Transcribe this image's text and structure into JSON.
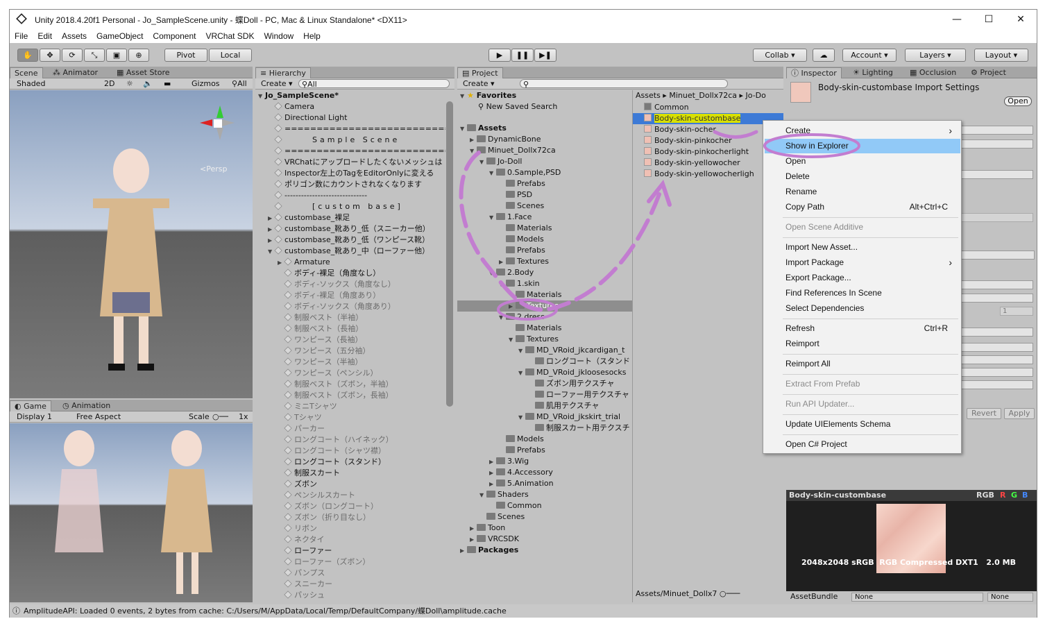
{
  "title": "Unity 2018.4.20f1 Personal - Jo_SampleScene.unity - 蝶Doll - PC, Mac & Linux Standalone* <DX11>",
  "menu": [
    "File",
    "Edit",
    "Assets",
    "GameObject",
    "Component",
    "VRChat SDK",
    "Window",
    "Help"
  ],
  "toolbar": {
    "pivot": "Pivot",
    "local": "Local",
    "collab": "Collab ▾",
    "account": "Account",
    "layers": "Layers",
    "layout": "Layout"
  },
  "scene": {
    "tabs": [
      "Scene",
      "Animator",
      "Asset Store"
    ],
    "shaded": "Shaded",
    "mode2d": "2D",
    "gizmos": "Gizmos",
    "persp": "<Persp",
    "search": "All"
  },
  "game": {
    "tabs": [
      "Game",
      "Animation"
    ],
    "display": "Display 1",
    "aspect": "Free Aspect",
    "scale": "Scale",
    "scale_val": "1x"
  },
  "hierarchy": {
    "tab": "Hierarchy",
    "create": "Create",
    "search": "All",
    "scene": "Jo_SampleScene*",
    "items": [
      {
        "t": "Camera",
        "d": 1,
        "g": false,
        "a": ""
      },
      {
        "t": "Directional Light",
        "d": 1,
        "g": false,
        "a": ""
      },
      {
        "t": "==============================",
        "d": 1,
        "g": false,
        "a": ""
      },
      {
        "t": "Sample Scene",
        "d": 1,
        "g": false,
        "a": "",
        "c": true
      },
      {
        "t": "==============================",
        "d": 1,
        "g": false,
        "a": ""
      },
      {
        "t": "VRChatにアップロードしたくないメッシュは",
        "d": 1,
        "g": false,
        "a": ""
      },
      {
        "t": "Inspector左上のTagをEditorOnlyに変える",
        "d": 1,
        "g": false,
        "a": ""
      },
      {
        "t": "ポリゴン数にカウントされなくなります",
        "d": 1,
        "g": false,
        "a": ""
      },
      {
        "t": "------------------------------",
        "d": 1,
        "g": false,
        "a": ""
      },
      {
        "t": "[custom base]",
        "d": 1,
        "g": false,
        "a": "",
        "c": true
      },
      {
        "t": "custombase_裸足",
        "d": 1,
        "g": false,
        "a": "▶"
      },
      {
        "t": "custombase_靴あり_低（スニーカー他）",
        "d": 1,
        "g": false,
        "a": "▶"
      },
      {
        "t": "custombase_靴あり_低（ワンピース靴）",
        "d": 1,
        "g": false,
        "a": "▶"
      },
      {
        "t": "custombase_靴あり_中（ローファー他）",
        "d": 1,
        "g": false,
        "a": "▼"
      },
      {
        "t": "Armature",
        "d": 2,
        "g": false,
        "a": "▶"
      },
      {
        "t": "ボディ-裸足（角度なし）",
        "d": 2,
        "g": false,
        "a": ""
      },
      {
        "t": "ボディ-ソックス（角度なし）",
        "d": 2,
        "g": true,
        "a": ""
      },
      {
        "t": "ボディ-裸足（角度あり）",
        "d": 2,
        "g": true,
        "a": ""
      },
      {
        "t": "ボディ-ソックス（角度あり）",
        "d": 2,
        "g": true,
        "a": ""
      },
      {
        "t": "制服ベスト（半袖）",
        "d": 2,
        "g": true,
        "a": ""
      },
      {
        "t": "制服ベスト（長袖）",
        "d": 2,
        "g": true,
        "a": ""
      },
      {
        "t": "ワンピース（長袖）",
        "d": 2,
        "g": true,
        "a": ""
      },
      {
        "t": "ワンピース（五分袖）",
        "d": 2,
        "g": true,
        "a": ""
      },
      {
        "t": "ワンピース（半袖）",
        "d": 2,
        "g": true,
        "a": ""
      },
      {
        "t": "ワンピース（ペンシル）",
        "d": 2,
        "g": true,
        "a": ""
      },
      {
        "t": "制服ベスト（ズボン，半袖）",
        "d": 2,
        "g": true,
        "a": ""
      },
      {
        "t": "制服ベスト（ズボン，長袖）",
        "d": 2,
        "g": true,
        "a": ""
      },
      {
        "t": "ミニTシャツ",
        "d": 2,
        "g": true,
        "a": ""
      },
      {
        "t": "Tシャツ",
        "d": 2,
        "g": true,
        "a": ""
      },
      {
        "t": "パーカー",
        "d": 2,
        "g": true,
        "a": ""
      },
      {
        "t": "ロングコート（ハイネック）",
        "d": 2,
        "g": true,
        "a": ""
      },
      {
        "t": "ロングコート（シャツ襟）",
        "d": 2,
        "g": true,
        "a": ""
      },
      {
        "t": "ロングコート（スタンド）",
        "d": 2,
        "g": false,
        "a": ""
      },
      {
        "t": "制服スカート",
        "d": 2,
        "g": false,
        "a": ""
      },
      {
        "t": "ズボン",
        "d": 2,
        "g": false,
        "a": ""
      },
      {
        "t": "ペンシルスカート",
        "d": 2,
        "g": true,
        "a": ""
      },
      {
        "t": "ズボン（ロングコート）",
        "d": 2,
        "g": true,
        "a": ""
      },
      {
        "t": "ズボン（折り目なし）",
        "d": 2,
        "g": true,
        "a": ""
      },
      {
        "t": "リボン",
        "d": 2,
        "g": true,
        "a": ""
      },
      {
        "t": "ネクタイ",
        "d": 2,
        "g": true,
        "a": ""
      },
      {
        "t": "ローファー",
        "d": 2,
        "g": false,
        "a": ""
      },
      {
        "t": "ローファー（ズボン）",
        "d": 2,
        "g": true,
        "a": ""
      },
      {
        "t": "パンプス",
        "d": 2,
        "g": true,
        "a": ""
      },
      {
        "t": "スニーカー",
        "d": 2,
        "g": true,
        "a": ""
      },
      {
        "t": "パッシュ",
        "d": 2,
        "g": true,
        "a": ""
      }
    ]
  },
  "project": {
    "tab": "Project",
    "create": "Create",
    "favorites": "Favorites",
    "new_saved_search": "New Saved Search",
    "assets": "Assets",
    "packages": "Packages",
    "tree": [
      {
        "t": "DynamicBone",
        "d": 1,
        "a": "▶"
      },
      {
        "t": "Minuet_Dollx72ca",
        "d": 1,
        "a": "▼"
      },
      {
        "t": "Jo-Doll",
        "d": 2,
        "a": "▼"
      },
      {
        "t": "0.Sample,PSD",
        "d": 3,
        "a": "▼"
      },
      {
        "t": "Prefabs",
        "d": 4,
        "a": ""
      },
      {
        "t": "PSD",
        "d": 4,
        "a": ""
      },
      {
        "t": "Scenes",
        "d": 4,
        "a": ""
      },
      {
        "t": "1.Face",
        "d": 3,
        "a": "▼"
      },
      {
        "t": "Materials",
        "d": 4,
        "a": ""
      },
      {
        "t": "Models",
        "d": 4,
        "a": ""
      },
      {
        "t": "Prefabs",
        "d": 4,
        "a": ""
      },
      {
        "t": "Textures",
        "d": 4,
        "a": "▶"
      },
      {
        "t": "2.Body",
        "d": 3,
        "a": "▼"
      },
      {
        "t": "1.skin",
        "d": 4,
        "a": "▼"
      },
      {
        "t": "Materials",
        "d": 5,
        "a": ""
      },
      {
        "t": "Textures",
        "d": 5,
        "a": "▶",
        "sel": true
      },
      {
        "t": "2.dress",
        "d": 4,
        "a": "▼"
      },
      {
        "t": "Materials",
        "d": 5,
        "a": ""
      },
      {
        "t": "Textures",
        "d": 5,
        "a": "▼"
      },
      {
        "t": "MD_VRoid_jkcardigan_t",
        "d": 6,
        "a": "▼"
      },
      {
        "t": "ロングコート（スタンド",
        "d": 7,
        "a": ""
      },
      {
        "t": "MD_VRoid_jkloosesocks",
        "d": 6,
        "a": "▼"
      },
      {
        "t": "ズボン用テクスチャ",
        "d": 7,
        "a": ""
      },
      {
        "t": "ローファー用テクスチャ",
        "d": 7,
        "a": ""
      },
      {
        "t": "肌用テクスチャ",
        "d": 7,
        "a": ""
      },
      {
        "t": "MD_VRoid_jkskirt_trial",
        "d": 6,
        "a": "▼"
      },
      {
        "t": "制服スカート用テクスチ",
        "d": 7,
        "a": ""
      },
      {
        "t": "Models",
        "d": 4,
        "a": ""
      },
      {
        "t": "Prefabs",
        "d": 4,
        "a": ""
      },
      {
        "t": "3.Wig",
        "d": 3,
        "a": "▶"
      },
      {
        "t": "4.Accessory",
        "d": 3,
        "a": "▶"
      },
      {
        "t": "5.Animation",
        "d": 3,
        "a": "▶"
      },
      {
        "t": "Shaders",
        "d": 2,
        "a": "▼"
      },
      {
        "t": "Common",
        "d": 3,
        "a": ""
      },
      {
        "t": "Scenes",
        "d": 2,
        "a": ""
      },
      {
        "t": "Toon",
        "d": 1,
        "a": "▶"
      },
      {
        "t": "VRCSDK",
        "d": 1,
        "a": "▶"
      }
    ],
    "breadcrumb": [
      "Assets",
      "Minuet_Dollx72ca",
      "Jo-Do"
    ],
    "files": [
      "Common",
      "Body-skin-custombase",
      "Body-skin-ocher",
      "Body-skin-pinkocher",
      "Body-skin-pinkocherlight",
      "Body-skin-yellowocher",
      "Body-skin-yellowocherligh"
    ],
    "footer": "Assets/Minuet_Dollx7"
  },
  "context_menu": {
    "items": [
      {
        "t": "Create",
        "k": "",
        "sub": true,
        "dis": false
      },
      {
        "t": "Show in Explorer",
        "k": "",
        "sub": false,
        "dis": false,
        "hl": true
      },
      {
        "t": "Open",
        "k": "",
        "sub": false,
        "dis": false
      },
      {
        "t": "Delete",
        "k": "",
        "sub": false,
        "dis": false
      },
      {
        "t": "Rename",
        "k": "",
        "sub": false,
        "dis": false
      },
      {
        "t": "Copy Path",
        "k": "Alt+Ctrl+C",
        "sub": false,
        "dis": false
      },
      {
        "sep": true
      },
      {
        "t": "Open Scene Additive",
        "k": "",
        "sub": false,
        "dis": true
      },
      {
        "sep": true
      },
      {
        "t": "Import New Asset...",
        "k": "",
        "sub": false,
        "dis": false
      },
      {
        "t": "Import Package",
        "k": "",
        "sub": true,
        "dis": false
      },
      {
        "t": "Export Package...",
        "k": "",
        "sub": false,
        "dis": false
      },
      {
        "t": "Find References In Scene",
        "k": "",
        "sub": false,
        "dis": false
      },
      {
        "t": "Select Dependencies",
        "k": "",
        "sub": false,
        "dis": false
      },
      {
        "sep": true
      },
      {
        "t": "Refresh",
        "k": "Ctrl+R",
        "sub": false,
        "dis": false
      },
      {
        "t": "Reimport",
        "k": "",
        "sub": false,
        "dis": false
      },
      {
        "sep": true
      },
      {
        "t": "Reimport All",
        "k": "",
        "sub": false,
        "dis": false
      },
      {
        "sep": true
      },
      {
        "t": "Extract From Prefab",
        "k": "",
        "sub": false,
        "dis": true
      },
      {
        "sep": true
      },
      {
        "t": "Run API Updater...",
        "k": "",
        "sub": false,
        "dis": true
      },
      {
        "sep": true
      },
      {
        "t": "Update UIElements Schema",
        "k": "",
        "sub": false,
        "dis": false
      },
      {
        "sep": true
      },
      {
        "t": "Open C# Project",
        "k": "",
        "sub": false,
        "dis": false
      }
    ]
  },
  "inspector": {
    "tabs": [
      "Inspector",
      "Lighting",
      "Occlusion",
      "Project"
    ],
    "title": "Body-skin-custombase Import Settings",
    "open": "Open",
    "revert": "Revert",
    "apply": "Apply",
    "num_1": "1",
    "preview_title": "Body-skin-custombase",
    "rgb": "RGB",
    "r": "R",
    "g": "G",
    "b": "B",
    "info": "2048x2048 sRGB  RGB Compressed DXT1   2.0 MB",
    "assetbundle": "AssetBundle",
    "none1": "None",
    "none2": "None"
  },
  "status": "AmplitudeAPI: Loaded 0 events, 2 bytes from cache: C:/Users/M/AppData/Local/Temp/DefaultCompany/蝶Doll\\amplitude.cache",
  "colors": {
    "panel": "#c2c2c2",
    "highlight": "#91c9f7",
    "selection_yellow": "#d8e000",
    "annotation": "#c27dd0"
  }
}
